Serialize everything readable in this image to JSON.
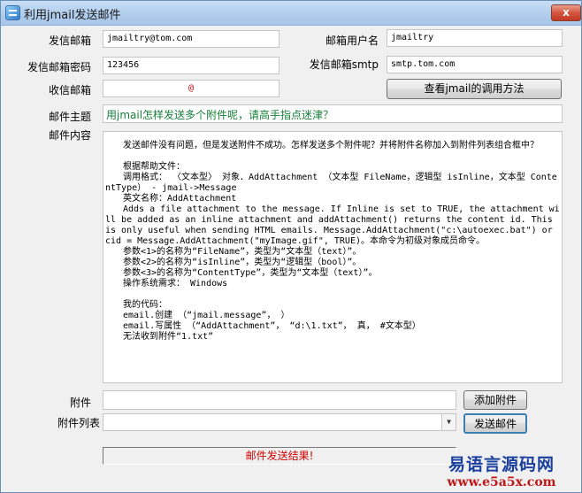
{
  "window": {
    "title": "利用jmail发送邮件",
    "close_label": "x"
  },
  "form": {
    "sender_email": {
      "label": "发信邮箱",
      "value": "jmailtry@tom.com"
    },
    "mail_user": {
      "label": "邮箱用户名",
      "value": "jmailtry"
    },
    "sender_password": {
      "label": "发信邮箱密码",
      "value": "123456"
    },
    "smtp": {
      "label": "发信邮箱smtp",
      "value": "smtp.tom.com"
    },
    "recipient": {
      "label": "收信邮箱",
      "value": "@"
    },
    "view_method_button": "查看jmail的调用方法",
    "subject": {
      "label": "邮件主题",
      "value": "用jmail怎样发送多个附件呢，请高手指点迷津？"
    },
    "content": {
      "label": "邮件内容",
      "value": "　　发送邮件没有问题，但是发送附件不成功。怎样发送多个附件呢？并将附件名称加入到附件列表组合框中？\n\n　　根据帮助文件：\n　　调用格式： 〈文本型〉 对象．AddAttachment （文本型 FileName，逻辑型 isInline，文本型 ContentType） - jmail->Message\n　　英文名称：AddAttachment\n　　Adds a file attachment to the message. If Inline is set to TRUE, the attachment will be added as an inline attachment and addAttachment() returns the content id. This is only useful when sending HTML emails. Message.AddAttachment(\"c:\\autoexec.bat\") or cid = Message.AddAttachment(\"myImage.gif\", TRUE)。本命令为初级对象成员命令。\n　　参数<1>的名称为“FileName”，类型为“文本型（text）”。\n　　参数<2>的名称为“isInline”，类型为“逻辑型（bool）”。\n　　参数<3>的名称为“ContentType”，类型为“文本型（text）”。\n　　操作系统需求： Windows\n\n　　我的代码：\n　　email.创建 （“jmail.message”， ）\n　　email.写属性 （“AddAttachment”， “d:\\1.txt”， 真， #文本型）\n　　无法收到附件“1.txt”"
    },
    "attachment": {
      "label": "附件",
      "value": ""
    },
    "add_attachment_button": "添加附件",
    "attachment_list": {
      "label": "附件列表",
      "value": ""
    },
    "send_button": "发送邮件",
    "status": "邮件发送结果!"
  },
  "watermark": {
    "line1": "易语言源码网",
    "line2": "www.e5a5x.com"
  },
  "colors": {
    "subject_text": "#18803a",
    "status_text": "#d40000",
    "recipient_text": "#cc0000"
  }
}
